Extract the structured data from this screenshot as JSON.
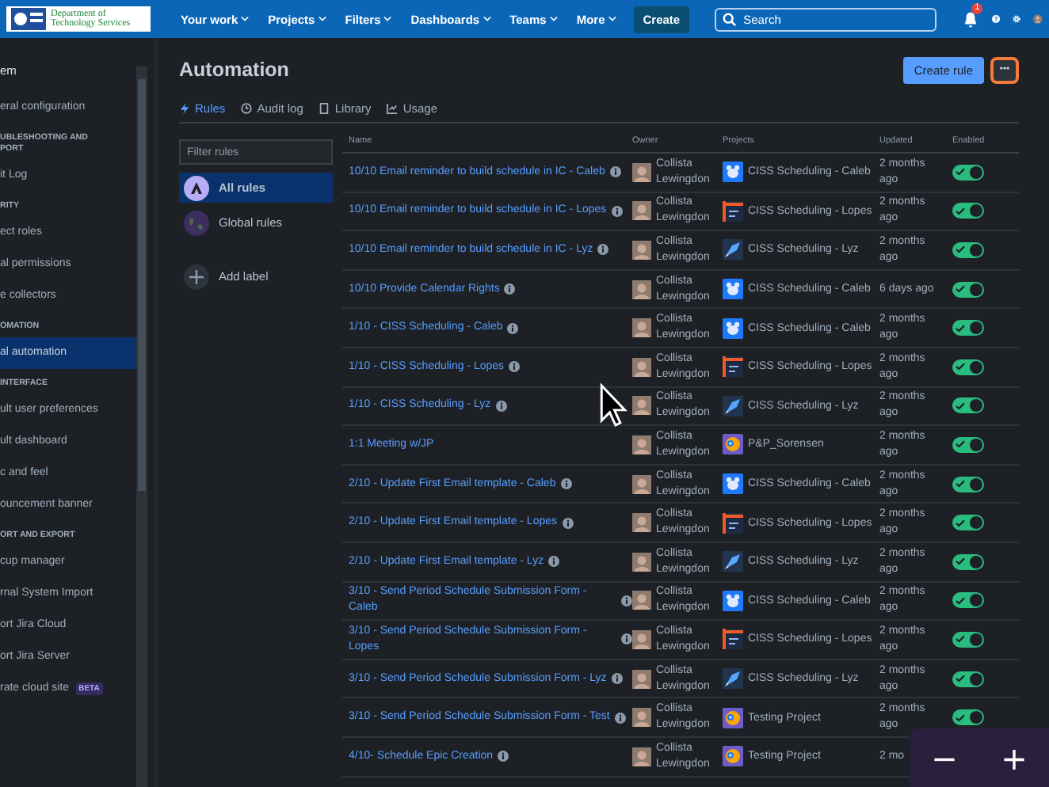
{
  "top_nav": {
    "logo_text": "Department of Technology Services",
    "items": [
      "Your work",
      "Projects",
      "Filters",
      "Dashboards",
      "Teams",
      "More"
    ],
    "create": "Create",
    "search": {
      "placeholder": "Search"
    },
    "notification_count": "1"
  },
  "sidebar": {
    "items": [
      {
        "kind": "title",
        "label": "em"
      },
      {
        "kind": "item",
        "label": "eral configuration",
        "selected": false
      },
      {
        "kind": "header",
        "label": "UBLESHOOTING AND PORT"
      },
      {
        "kind": "item",
        "label": "it Log",
        "selected": false
      },
      {
        "kind": "header",
        "label": "RITY"
      },
      {
        "kind": "item",
        "label": "ect roles",
        "selected": false
      },
      {
        "kind": "item",
        "label": "al permissions",
        "selected": false
      },
      {
        "kind": "item",
        "label": "e collectors",
        "selected": false
      },
      {
        "kind": "header",
        "label": "OMATION"
      },
      {
        "kind": "item",
        "label": "al automation",
        "selected": true
      },
      {
        "kind": "header",
        "label": "INTERFACE"
      },
      {
        "kind": "item",
        "label": "ult user preferences",
        "selected": false
      },
      {
        "kind": "item",
        "label": "ult dashboard",
        "selected": false
      },
      {
        "kind": "item",
        "label": "c and feel",
        "selected": false
      },
      {
        "kind": "item",
        "label": "ouncement banner",
        "selected": false
      },
      {
        "kind": "header",
        "label": "ORT AND EXPORT"
      },
      {
        "kind": "item",
        "label": "cup manager",
        "selected": false
      },
      {
        "kind": "item",
        "label": "rnal System Import",
        "selected": false
      },
      {
        "kind": "item",
        "label": "ort Jira Cloud",
        "selected": false
      },
      {
        "kind": "item",
        "label": "ort Jira Server",
        "selected": false
      },
      {
        "kind": "item",
        "label": "rate cloud site",
        "selected": false,
        "badge": "BETA"
      }
    ]
  },
  "page": {
    "title": "Automation",
    "create_button": "Create rule",
    "more_button": "•••"
  },
  "tabs": [
    {
      "label": "Rules",
      "selected": true
    },
    {
      "label": "Audit log",
      "selected": false
    },
    {
      "label": "Library",
      "selected": false
    },
    {
      "label": "Usage",
      "selected": false
    }
  ],
  "filter": {
    "placeholder": "Filter rules",
    "items": [
      {
        "label": "All rules",
        "selected": true
      },
      {
        "label": "Global rules",
        "selected": false
      },
      {
        "label": "Add label",
        "selected": false
      }
    ]
  },
  "table": {
    "columns": [
      "Name",
      "Owner",
      "Projects",
      "Updated",
      "Enabled"
    ],
    "rows": [
      {
        "name": "10/10 Email reminder to build schedule in IC - Caleb",
        "info": true,
        "owner": "Collista Lewingdon",
        "project": "CISS Scheduling - Caleb",
        "kind": "bear",
        "updated": "2 months ago",
        "enabled": true
      },
      {
        "name": "10/10 Email reminder to build schedule in IC - Lopes",
        "info": true,
        "owner": "Collista Lewingdon",
        "project": "CISS Scheduling - Lopes",
        "kind": "lines",
        "updated": "2 months ago",
        "enabled": true
      },
      {
        "name": "10/10 Email reminder to build schedule in IC - Lyz",
        "info": true,
        "owner": "Collista Lewingdon",
        "project": "CISS Scheduling - Lyz",
        "kind": "rocket",
        "updated": "2 months ago",
        "enabled": true
      },
      {
        "name": "10/10 Provide Calendar Rights",
        "info": true,
        "owner": "Collista Lewingdon",
        "project": "CISS Scheduling - Caleb",
        "kind": "bear",
        "updated": "6 days ago",
        "enabled": true
      },
      {
        "name": "1/10 - CISS Scheduling - Caleb",
        "info": true,
        "owner": "Collista Lewingdon",
        "project": "CISS Scheduling - Caleb",
        "kind": "bear",
        "updated": "2 months ago",
        "enabled": true
      },
      {
        "name": "1/10 - CISS Scheduling - Lopes",
        "info": true,
        "owner": "Collista Lewingdon",
        "project": "CISS Scheduling - Lopes",
        "kind": "lines",
        "updated": "2 months ago",
        "enabled": true
      },
      {
        "name": "1/10 - CISS Scheduling - Lyz",
        "info": true,
        "owner": "Collista Lewingdon",
        "project": "CISS Scheduling - Lyz",
        "kind": "rocket",
        "updated": "2 months ago",
        "enabled": true
      },
      {
        "name": "1:1 Meeting w/JP",
        "info": false,
        "owner": "Collista Lewingdon",
        "project": "P&P_Sorensen",
        "kind": "duck",
        "updated": "2 months ago",
        "enabled": true
      },
      {
        "name": "2/10 - Update First Email template - Caleb",
        "info": true,
        "owner": "Collista Lewingdon",
        "project": "CISS Scheduling - Caleb",
        "kind": "bear",
        "updated": "2 months ago",
        "enabled": true
      },
      {
        "name": "2/10 - Update First Email template - Lopes",
        "info": true,
        "owner": "Collista Lewingdon",
        "project": "CISS Scheduling - Lopes",
        "kind": "lines",
        "updated": "2 months ago",
        "enabled": true
      },
      {
        "name": "2/10 - Update First Email template - Lyz",
        "info": true,
        "owner": "Collista Lewingdon",
        "project": "CISS Scheduling - Lyz",
        "kind": "rocket",
        "updated": "2 months ago",
        "enabled": true
      },
      {
        "name": "3/10 - Send Period Schedule Submission Form - Caleb",
        "info": true,
        "owner": "Collista Lewingdon",
        "project": "CISS Scheduling - Caleb",
        "kind": "bear",
        "updated": "2 months ago",
        "enabled": true
      },
      {
        "name": "3/10 - Send Period Schedule Submission Form - Lopes",
        "info": true,
        "owner": "Collista Lewingdon",
        "project": "CISS Scheduling - Lopes",
        "kind": "lines",
        "updated": "2 months ago",
        "enabled": true
      },
      {
        "name": "3/10 - Send Period Schedule Submission Form - Lyz",
        "info": true,
        "owner": "Collista Lewingdon",
        "project": "CISS Scheduling - Lyz",
        "kind": "rocket",
        "updated": "2 months ago",
        "enabled": true
      },
      {
        "name": "3/10 - Send Period Schedule Submission Form - Test",
        "info": true,
        "owner": "Collista Lewingdon",
        "project": "Testing Project",
        "kind": "duck",
        "updated": "2 months ago",
        "enabled": true
      },
      {
        "name": "4/10- Schedule Epic Creation",
        "info": true,
        "owner": "Collista Lewingdon",
        "project": "Testing Project",
        "kind": "duck",
        "updated": "2 mo"
      }
    ]
  },
  "zoom_controls": {
    "minus": "−",
    "plus": "+"
  }
}
